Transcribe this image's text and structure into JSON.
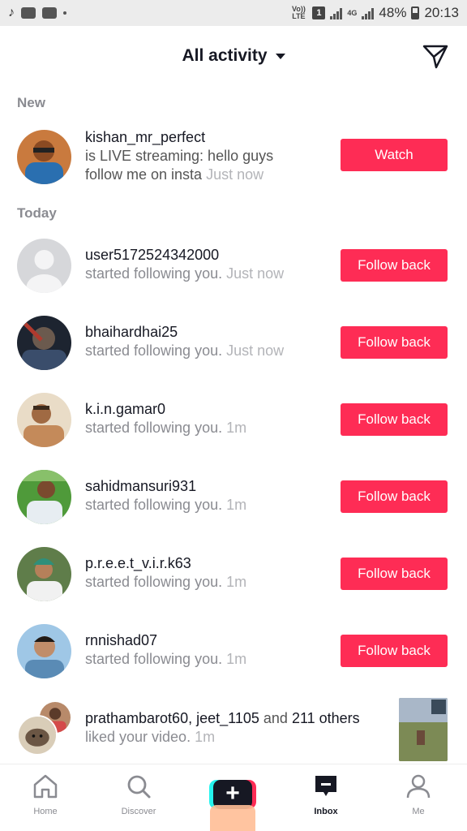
{
  "status_bar": {
    "volte": "Vo)) LTE",
    "sim": "1",
    "network": "4G",
    "battery": "48%",
    "time": "20:13"
  },
  "header": {
    "title": "All activity",
    "send_icon": "paper-plane-icon"
  },
  "sections": {
    "new": "New",
    "today": "Today"
  },
  "notifications": [
    {
      "username": "kishan_mr_perfect",
      "line1": "is LIVE streaming: hello guys",
      "line2": "follow me on insta",
      "time": "Just now",
      "button": "Watch"
    },
    {
      "username": "user5172524342000",
      "activity": "started following you.",
      "time": "Just now",
      "button": "Follow back"
    },
    {
      "username": "bhaihardhai25",
      "activity": "started following you.",
      "time": "Just now",
      "button": "Follow back"
    },
    {
      "username": "k.i.n.gamar0",
      "activity": "started following you.",
      "time": "1m",
      "button": "Follow back"
    },
    {
      "username": "sahidmansuri931",
      "activity": "started following you.",
      "time": "1m",
      "button": "Follow back"
    },
    {
      "username": "p.r.e.e.t_v.i.r.k63",
      "activity": "started following you.",
      "time": "1m",
      "button": "Follow back"
    },
    {
      "username": "rnnishad07",
      "activity": "started following you.",
      "time": "1m",
      "button": "Follow back"
    }
  ],
  "likes": {
    "user1": "prathambarot60",
    "separator": ",",
    "user2": "jeet_1105",
    "and": "and",
    "others": "211 others",
    "activity": "liked your video.",
    "time": "1m"
  },
  "bottom_nav": {
    "home": "Home",
    "discover": "Discover",
    "inbox": "Inbox",
    "me": "Me"
  },
  "colors": {
    "accent": "#fe2c55",
    "cyan": "#25f4ee",
    "text": "#161823",
    "muted": "#8a8b91"
  }
}
